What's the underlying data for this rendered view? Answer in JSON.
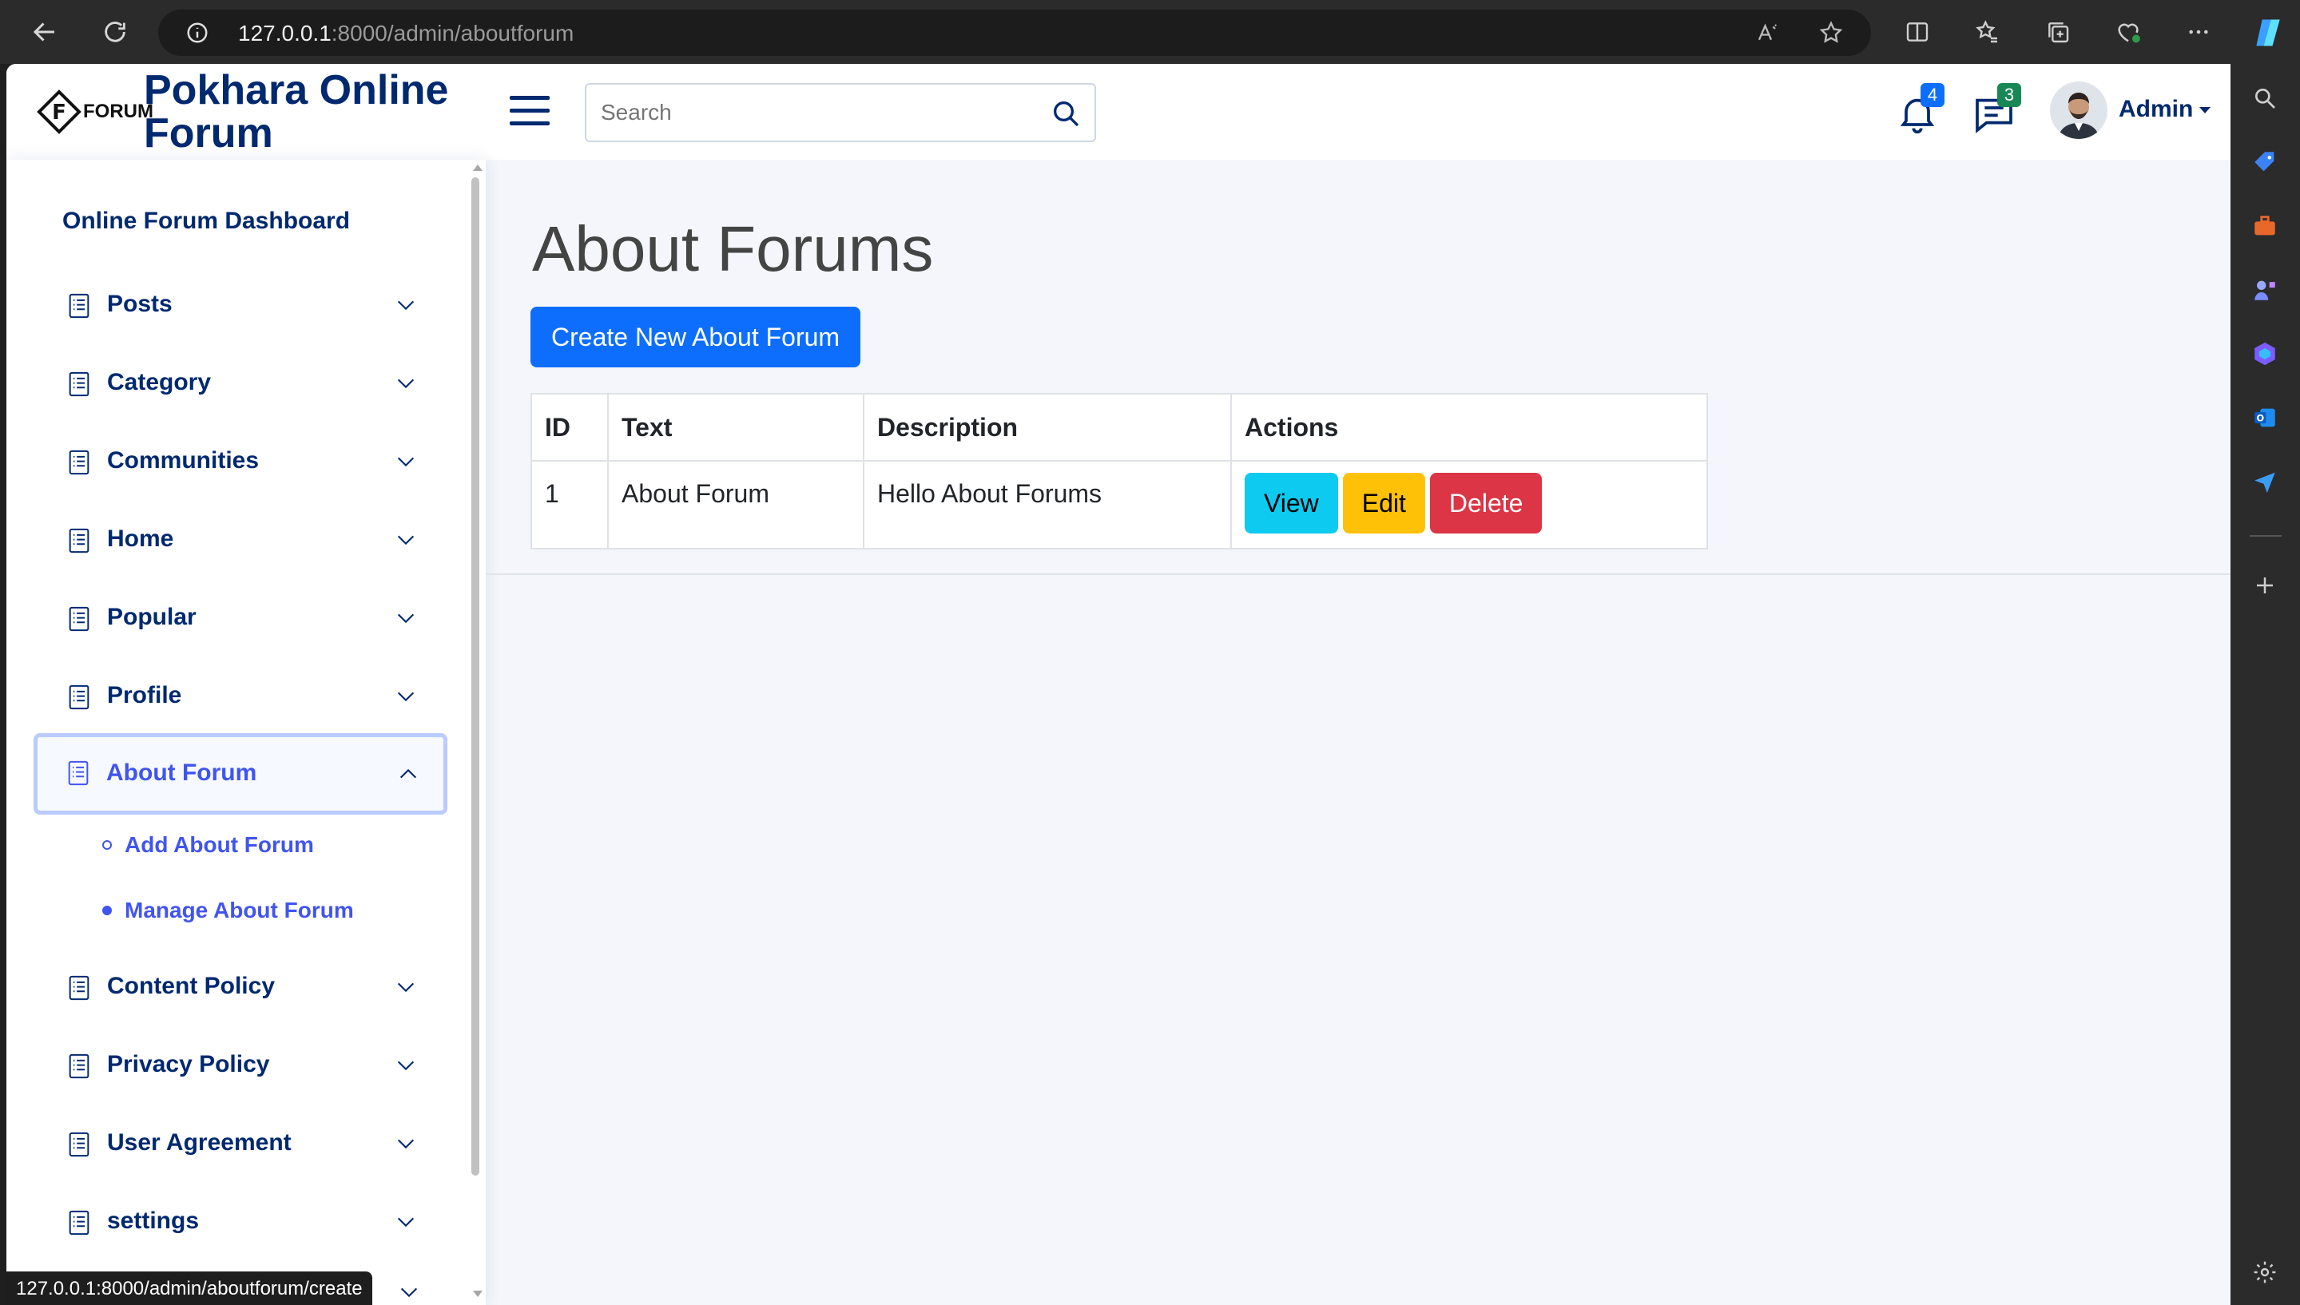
{
  "browser": {
    "url_host": "127.0.0.1",
    "url_path": ":8000/admin/aboutforum",
    "status_url": "127.0.0.1:8000/admin/aboutforum/create"
  },
  "header": {
    "logo_text": "FORUM",
    "brand": "Pokhara Online Forum",
    "search_placeholder": "Search",
    "notifications_count": "4",
    "messages_count": "3",
    "user_name": "Admin"
  },
  "sidebar": {
    "heading": "Online Forum Dashboard",
    "items": [
      {
        "label": "Posts"
      },
      {
        "label": "Category"
      },
      {
        "label": "Communities"
      },
      {
        "label": "Home"
      },
      {
        "label": "Popular"
      },
      {
        "label": "Profile"
      },
      {
        "label": "About Forum"
      },
      {
        "label": "Content Policy"
      },
      {
        "label": "Privacy Policy"
      },
      {
        "label": "User Agreement"
      },
      {
        "label": "settings"
      }
    ],
    "sub_items": [
      {
        "label": "Add About Forum"
      },
      {
        "label": "Manage About Forum"
      }
    ]
  },
  "main": {
    "title": "About Forums",
    "create_button": "Create New About Forum",
    "table": {
      "headers": [
        "ID",
        "Text",
        "Description",
        "Actions"
      ],
      "rows": [
        {
          "id": "1",
          "text": "About Forum",
          "description": "Hello About Forums"
        }
      ],
      "actions": {
        "view": "View",
        "edit": "Edit",
        "delete": "Delete"
      }
    }
  },
  "colors": {
    "brand": "#012970",
    "accent": "#4154f1",
    "primary": "#0d6efd",
    "info": "#0dcaf0",
    "warning": "#ffc107",
    "danger": "#dc3545"
  }
}
